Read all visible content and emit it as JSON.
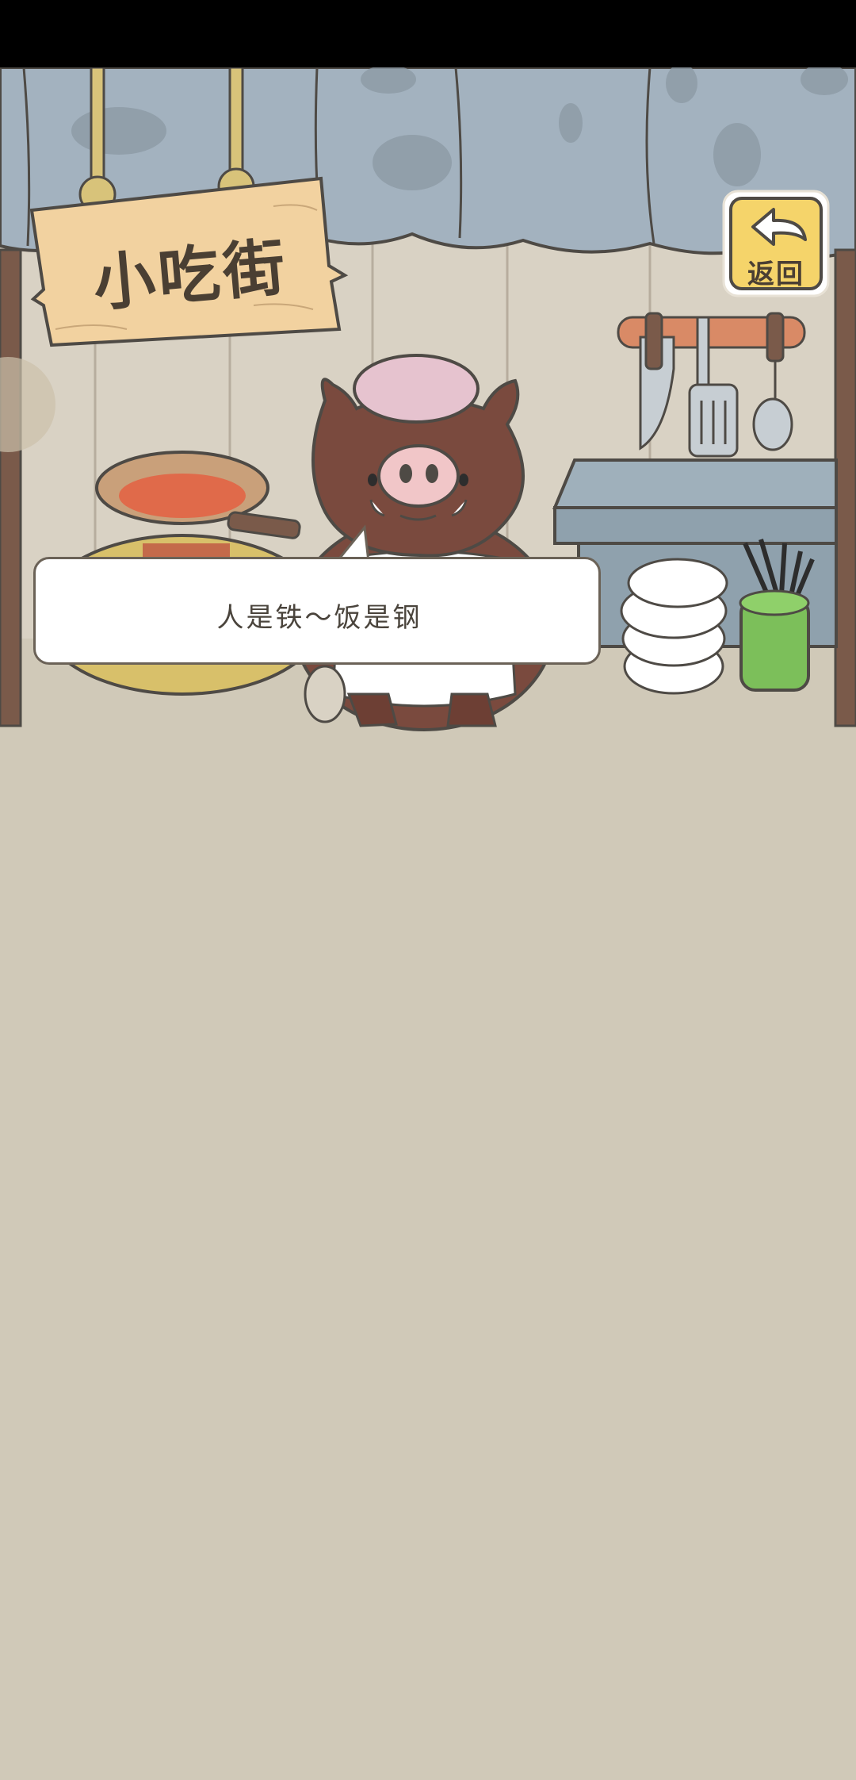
{
  "screen": "小吃街",
  "sign": {
    "title": "小吃街"
  },
  "back_button": {
    "label": "返回",
    "icon": "back-arrow-icon"
  },
  "dialogue": {
    "text": "人是铁～饭是钢"
  },
  "colors": {
    "background": "#d0c9b8",
    "curtain": "#a3b2bf",
    "wall": "#d9d2c4",
    "button_fill": "#f5d46a",
    "boar_fur": "#7a4a3e",
    "counter": "#8fa1ad"
  }
}
